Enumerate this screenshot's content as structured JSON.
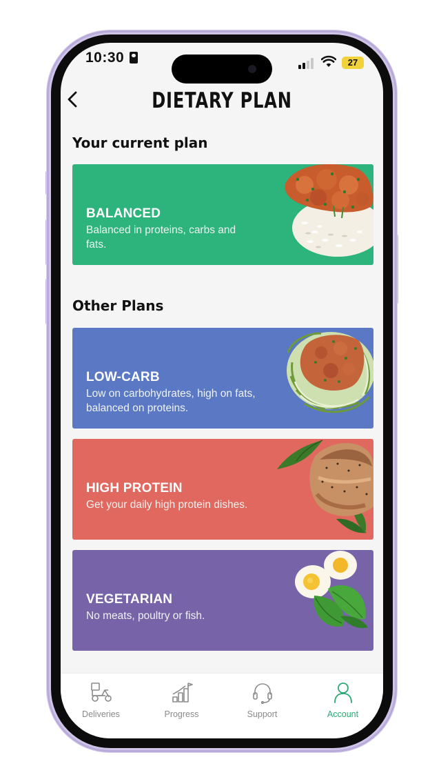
{
  "status_bar": {
    "time": "10:30",
    "battery": "27"
  },
  "header": {
    "title": "DIETARY PLAN"
  },
  "current_section": {
    "title": "Your current plan",
    "plan": {
      "name": "BALANCED",
      "description": "Balanced in proteins, carbs and fats.",
      "color": "#2db47c"
    }
  },
  "other_section": {
    "title": "Other Plans",
    "plans": [
      {
        "name": "LOW-CARB",
        "description": "Low on carbohydrates, high on fats, balanced on proteins.",
        "color": "#5a78c4"
      },
      {
        "name": "HIGH PROTEIN",
        "description": "Get your daily high protein dishes.",
        "color": "#e0685f"
      },
      {
        "name": "VEGETARIAN",
        "description": "No meats, poultry or fish.",
        "color": "#7763a7"
      }
    ]
  },
  "tabbar": {
    "items": [
      {
        "label": "Deliveries",
        "icon": "delivery-scooter-icon"
      },
      {
        "label": "Progress",
        "icon": "progress-chart-icon"
      },
      {
        "label": "Support",
        "icon": "headset-icon"
      },
      {
        "label": "Account",
        "icon": "user-icon"
      }
    ],
    "active_index": 3,
    "active_color": "#2aa874"
  }
}
